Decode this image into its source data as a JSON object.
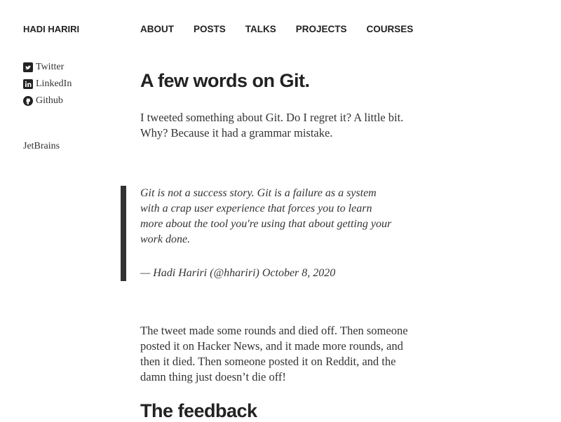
{
  "site": {
    "title": "HADI HARIRI"
  },
  "social": [
    {
      "icon": "twitter-icon",
      "label": "Twitter"
    },
    {
      "icon": "linkedin-icon",
      "label": "LinkedIn"
    },
    {
      "icon": "github-icon",
      "label": "Github"
    }
  ],
  "employer": "JetBrains",
  "nav": [
    {
      "label": "ABOUT"
    },
    {
      "label": "POSTS"
    },
    {
      "label": "TALKS"
    },
    {
      "label": "PROJECTS"
    },
    {
      "label": "COURSES"
    }
  ],
  "post": {
    "title": "A few words on Git.",
    "intro": "I tweeted something about Git. Do I regret it? A little bit. Why? Because it had a grammar mistake.",
    "quote": {
      "text": "Git is not a success story. Git is a failure as a system with a crap user experience that forces you to learn more about the tool you're using that about getting your work done.",
      "author": "— Hadi Hariri (@hhariri)",
      "date_link": "October 8, 2020"
    },
    "para2": "The tweet made some rounds and died off. Then someone posted it on Hacker News, and it made more rounds, and then it died. Then someone posted it on Reddit, and the damn thing just doesn’t die off!",
    "section_heading": "The feedback"
  }
}
